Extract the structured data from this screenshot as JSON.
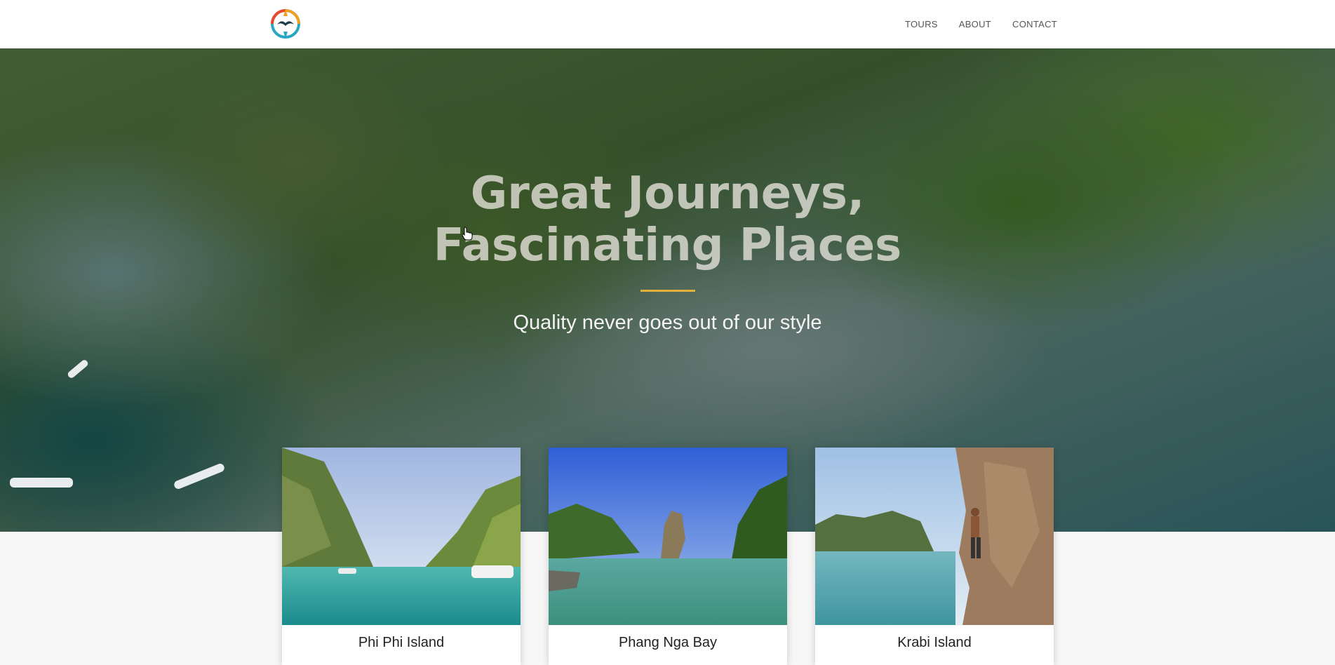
{
  "navbar": {
    "logo_icon": "compass-bird-logo-icon",
    "links": [
      {
        "label": "TOURS"
      },
      {
        "label": "ABOUT"
      },
      {
        "label": "CONTACT"
      }
    ]
  },
  "hero": {
    "title_line1": "Great Journeys,",
    "title_line2": "Fascinating Places",
    "subtitle": "Quality never goes out of our style",
    "accent_color": "#e2b13c"
  },
  "tours": [
    {
      "title": "Phi Phi Island",
      "image_icon": "lagoon-cliffs-photo"
    },
    {
      "title": "Phang Nga Bay",
      "image_icon": "limestone-rock-bay-photo"
    },
    {
      "title": "Krabi Island",
      "image_icon": "rock-climber-photo"
    }
  ]
}
